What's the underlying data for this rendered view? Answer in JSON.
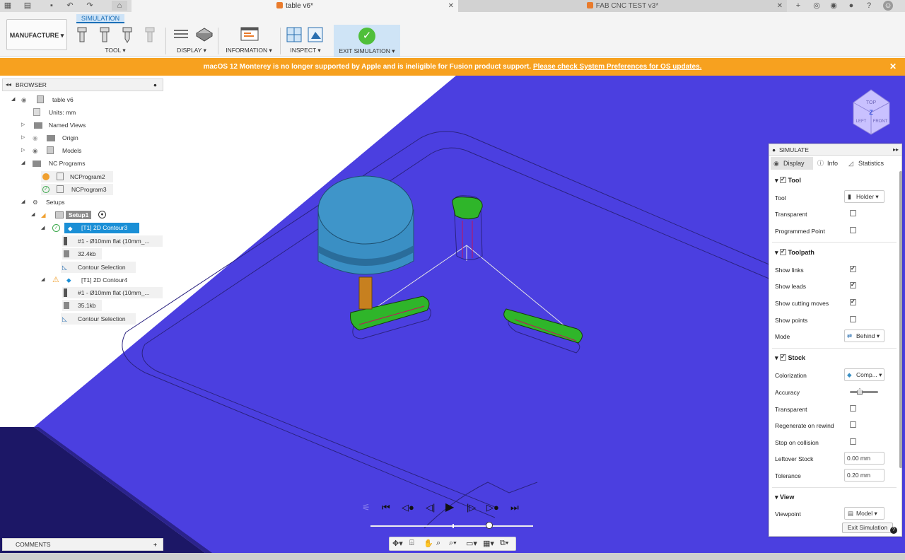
{
  "tabs": [
    {
      "title": "table v6*"
    },
    {
      "title": "FAB CNC TEST v3*"
    }
  ],
  "toolbar": {
    "workspace": "MANUFACTURE",
    "context_tab": "SIMULATION",
    "groups": [
      "TOOL",
      "DISPLAY",
      "INFORMATION",
      "INSPECT",
      "EXIT SIMULATION"
    ]
  },
  "banner": {
    "message": "macOS 12 Monterey is no longer supported by Apple and is ineligible for Fusion product support.",
    "link": "Please check System Preferences for OS updates."
  },
  "browser": {
    "title": "BROWSER",
    "items": [
      {
        "label": "table v6"
      },
      {
        "label": "Units: mm"
      },
      {
        "label": "Named Views"
      },
      {
        "label": "Origin"
      },
      {
        "label": "Models"
      },
      {
        "label": "NC Programs"
      },
      {
        "label": "NCProgram2"
      },
      {
        "label": "NCProgram3"
      },
      {
        "label": "Setups"
      },
      {
        "label": "Setup1"
      },
      {
        "label": "[T1] 2D Contour3"
      },
      {
        "label": "#1 - Ø10mm flat (10mm_..."
      },
      {
        "label": "32.4kb"
      },
      {
        "label": "Contour Selection"
      },
      {
        "label": "[T1] 2D Contour4"
      },
      {
        "label": "#1 - Ø10mm flat (10mm_..."
      },
      {
        "label": "35.1kb"
      },
      {
        "label": "Contour Selection"
      }
    ]
  },
  "comments": {
    "title": "COMMENTS"
  },
  "viewcube": {
    "top": "TOP",
    "left": "LEFT",
    "front": "FRONT",
    "axis_z": "Z"
  },
  "simulate": {
    "title": "SIMULATE",
    "tabs": [
      "Display",
      "Info",
      "Statistics"
    ],
    "sections": {
      "tool": {
        "title": "Tool",
        "enabled": true,
        "tool_label": "Tool",
        "tool_value": "Holder",
        "transparent_label": "Transparent",
        "transparent": false,
        "programmed_point_label": "Programmed Point",
        "programmed_point": false
      },
      "toolpath": {
        "title": "Toolpath",
        "enabled": true,
        "show_links_label": "Show links",
        "show_links": true,
        "show_leads_label": "Show leads",
        "show_leads": true,
        "show_cutting_label": "Show cutting moves",
        "show_cutting": true,
        "show_points_label": "Show points",
        "show_points": false,
        "mode_label": "Mode",
        "mode_value": "Behind"
      },
      "stock": {
        "title": "Stock",
        "enabled": true,
        "colorization_label": "Colorization",
        "colorization_value": "Comp...",
        "accuracy_label": "Accuracy",
        "accuracy_level": 0.35,
        "transparent_label": "Transparent",
        "transparent": false,
        "regenerate_label": "Regenerate on rewind",
        "regenerate": false,
        "stop_label": "Stop on collision",
        "stop": false,
        "leftover_label": "Leftover Stock",
        "leftover_value": "0.00 mm",
        "tolerance_label": "Tolerance",
        "tolerance_value": "0.20 mm"
      },
      "view": {
        "title": "View",
        "viewpoint_label": "Viewpoint",
        "viewpoint_value": "Model"
      }
    },
    "exit_button": "Exit Simulation"
  },
  "playback": {
    "position": 0.73
  },
  "colors": {
    "stock": "#4b3fe0",
    "accent": "#f7a11f",
    "green": "#2fb52a",
    "tool_blue": "#3a8fc4"
  }
}
